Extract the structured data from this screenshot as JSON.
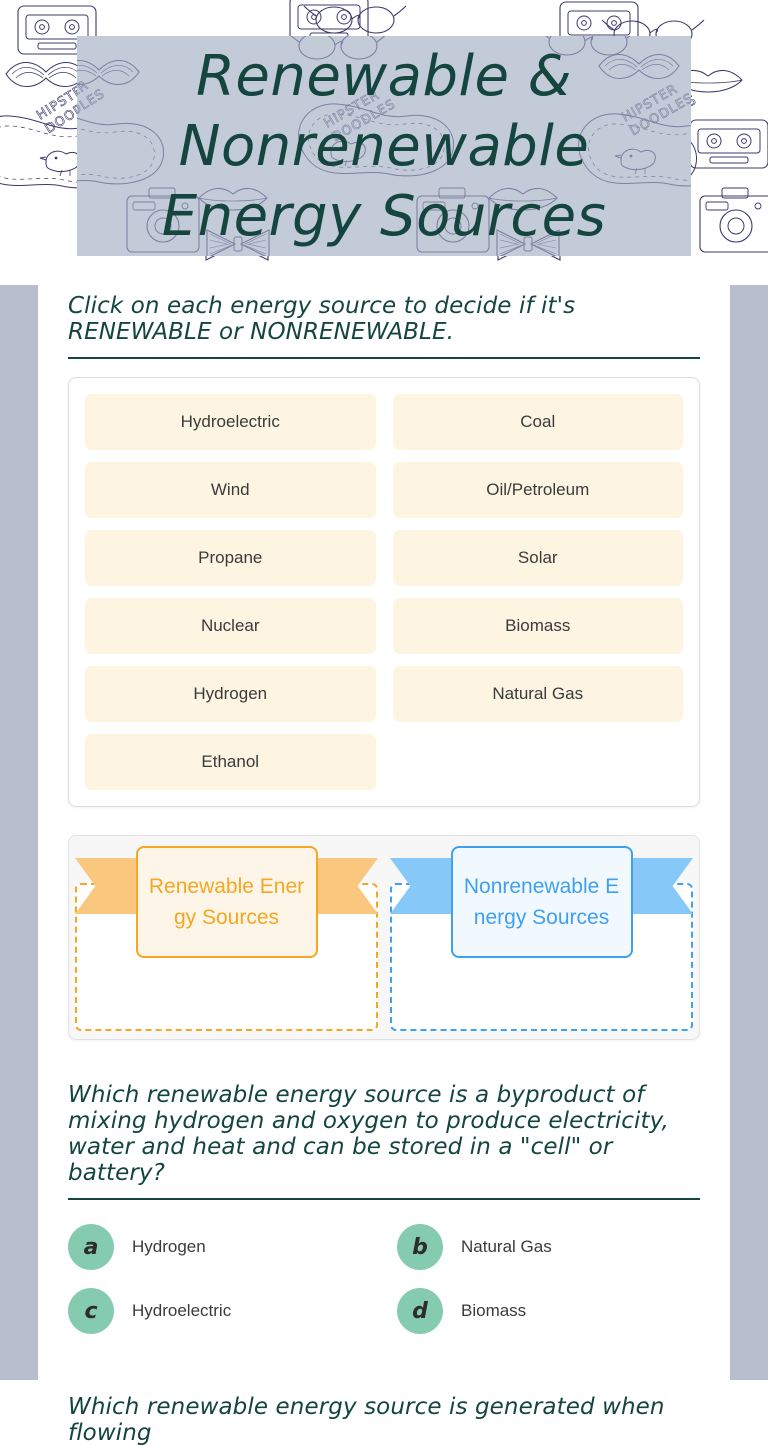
{
  "theme": {
    "title_color": "#14453f",
    "banner_bg": "#c3cad8",
    "rail_color": "#b7bfce",
    "tile_bg": "#fdf4e2",
    "renewable_accent": "#f5a623",
    "nonrenewable_accent": "#3fa0f0",
    "bubble_color": "#84cbaf"
  },
  "header": {
    "title": "Renewable & Nonrenewable Energy Sources"
  },
  "instructions": {
    "text": "Click on each energy source to decide if it's RENEWABLE or NONRENEWABLE."
  },
  "word_bank": {
    "tiles": [
      {
        "label": "Hydroelectric"
      },
      {
        "label": "Coal"
      },
      {
        "label": "Wind"
      },
      {
        "label": "Oil/Petroleum"
      },
      {
        "label": "Propane"
      },
      {
        "label": "Solar"
      },
      {
        "label": "Nuclear"
      },
      {
        "label": "Biomass"
      },
      {
        "label": "Hydrogen"
      },
      {
        "label": "Natural Gas"
      },
      {
        "label": "Ethanol"
      }
    ]
  },
  "categories": [
    {
      "label": "Renewable Energy Sources",
      "accent": "#f5a623"
    },
    {
      "label": "Nonrenewable Energy Sources",
      "accent": "#3fa0f0"
    }
  ],
  "questions": [
    {
      "text": "Which renewable energy source is a byproduct of mixing hydrogen and oxygen to produce electricity, water and heat and can be stored in a \"cell\" or battery?",
      "options": [
        {
          "letter": "a",
          "label": "Hydrogen"
        },
        {
          "letter": "b",
          "label": "Natural Gas"
        },
        {
          "letter": "c",
          "label": "Hydroelectric"
        },
        {
          "letter": "d",
          "label": "Biomass"
        }
      ]
    },
    {
      "text": "Which renewable energy source is generated when flowing"
    }
  ]
}
